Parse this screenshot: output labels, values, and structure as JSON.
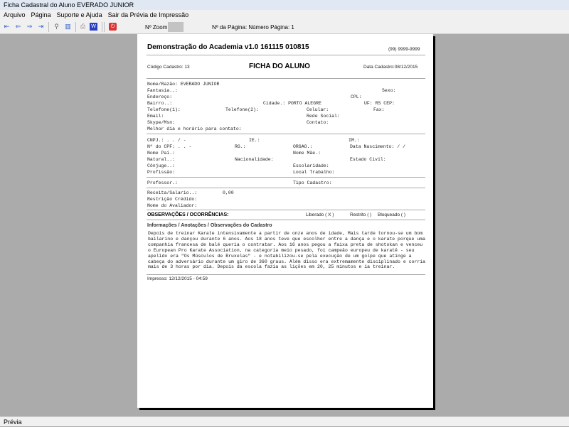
{
  "window": {
    "title": "Ficha Cadastral do Aluno EVERADO JUNIOR"
  },
  "menu": [
    "Arquivo",
    "Página",
    "Suporte e Ajuda",
    "Sair da Prévia de Impressão"
  ],
  "toolbar": {
    "zoom_label": "Nº Zoom",
    "page_label": "Nº da Página: Número Página: 1"
  },
  "status": "Prévia",
  "report": {
    "company": "Demonstração do Academia v1.0 161115 010815",
    "phone": "(99) 9999-9999",
    "codigo": "Código Cadastro:   13",
    "title": "FICHA DO ALUNO",
    "data_cadastro": "Data Cadastro:08/12/2015",
    "f": {
      "nome": "Nome/Razão: EVERADO JUNIOR",
      "fantasia": "Fantasia..:",
      "sexo": "Sexo:",
      "endereco": "Endereço:",
      "cpl": "CPL:",
      "bairro": "Bairro..:",
      "cidade": "Cidade.: PORTO ALEGRE",
      "uf": "UF: RS CEP:",
      "tel1": "Telefone(1):",
      "tel2": "Telefone(2):",
      "celular": "Celular:",
      "fax": "Fax:",
      "email": "Email:",
      "rede": "Rede Social:",
      "skype": "Skype/Msn:",
      "contato": "Contato:",
      "melhor": "Melhor dia e horário para contato:",
      "cnpj": "CNPJ.:    .   .   /    -",
      "ie": "IE.:",
      "im": "IM.:",
      "cpf": "Nº do CPF:    .   .    -",
      "rg": "RG.:",
      "orgao": "ORGAO.:",
      "nasc": "Data Nascimento:   /  /",
      "pai": "Nome Pai.:",
      "mae": "Nome Mãe.:",
      "natural": "Natural..:",
      "nacionalidade": "Nacionalidade:",
      "civil": "Estado Civil:",
      "conjuge": "Cônjuge..:",
      "escolaridade": "Escolaridade:",
      "profissao": "Profissão:",
      "trabalho": "Local Trabalho:",
      "professor": "Professor.:",
      "tipo": "Tipo Cadastro:",
      "receita": "Receita/Salario..:",
      "receita_val": "0,00",
      "restricao": "Restrição Crédido:",
      "avaliador": "Nome do Avaliador:"
    },
    "obs_title": "OBSERVAÇÕES / OCORRÊNCIAS:",
    "liberado": "Liberado ( X )",
    "restrito": "Restrito (  )",
    "bloqueado": "Bloqueado (  )",
    "info_title": "Informações / Anotações / Observações do Cadastro",
    "notes": "Depois de treinar Karate intensivamente a partir de onze anos de idade, Mais tarde tornou-se um bom bailarino e dançou durante 6 anos. Aos 18 anos teve que escolher entre a dança e o karate porque uma companhia francesa de balé queria o contratar. Aos 16 anos pegou a faixa preta de shotokan e venceu o European Pro Karate Association, na categoria meio pesado, foi campeão europeu de karatê - seu apelido era \"Os Músculos de Bruxelas\" - e notabilizou-se pela execução de um golpe que atinge a cabeça do adversário durante um giro de 360 graus. Além disso era extremamente disciplinado e corria mais de 3 horas por dia. Depois da escola fazia as lições em 20, 25 minutos e ia treinar.",
    "impresso": "Impresso: 12/12/2015 - 04:59"
  }
}
